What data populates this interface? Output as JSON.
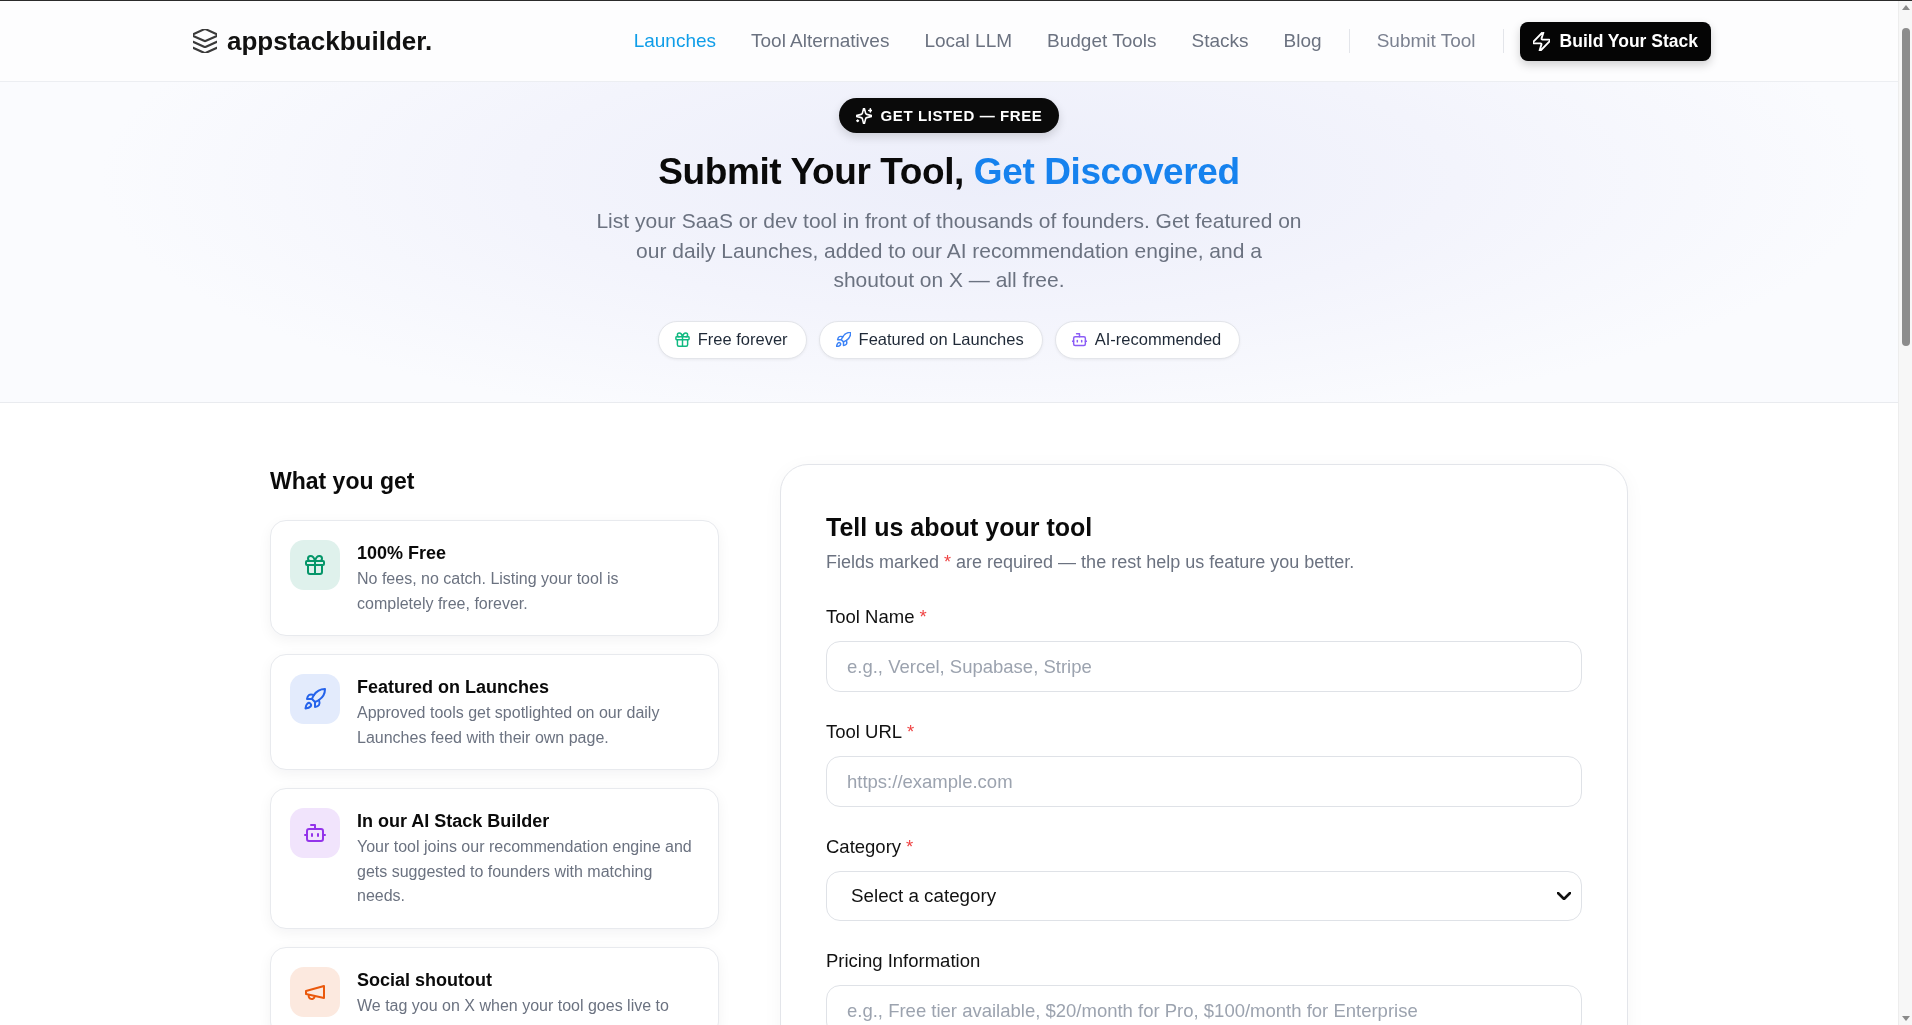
{
  "header": {
    "logo": "appstackbuilder.",
    "nav": [
      {
        "label": "Launches",
        "selected": true
      },
      {
        "label": "Tool Alternatives",
        "selected": false
      },
      {
        "label": "Local LLM",
        "selected": false
      },
      {
        "label": "Budget Tools",
        "selected": false
      },
      {
        "label": "Stacks",
        "selected": false
      },
      {
        "label": "Blog",
        "selected": false
      }
    ],
    "submit_link": "Submit Tool",
    "cta_button": "Build Your Stack"
  },
  "hero": {
    "badge": "GET LISTED — FREE",
    "title": "Submit Your Tool,",
    "title_highlight": "Get Discovered",
    "description": "List your SaaS or dev tool in front of thousands of founders. Get featured on our daily Launches, added to our AI recommendation engine, and a shoutout on X — all free.",
    "pills": [
      {
        "label": "Free forever",
        "kind": "gift",
        "color": "#10b981"
      },
      {
        "label": "Featured on Launches",
        "kind": "rocket",
        "color": "#3b82f6"
      },
      {
        "label": "AI-recommended",
        "kind": "robot",
        "color": "#8b5cf6"
      }
    ]
  },
  "benefits": {
    "title": "What you get",
    "items": [
      {
        "title": "100% Free",
        "description": "No fees, no catch. Listing your tool is completely free, forever.",
        "kind": "gift",
        "color": "#059669"
      },
      {
        "title": "Featured on Launches",
        "description": "Approved tools get spotlighted on our daily Launches feed with their own page.",
        "kind": "rocket",
        "color": "#2563eb"
      },
      {
        "title": "In our AI Stack Builder",
        "description": "Your tool joins our recommendation engine and gets suggested to founders with matching needs.",
        "kind": "robot",
        "color": "#9333ea"
      },
      {
        "title": "Social shoutout",
        "description": "We tag you on X when your tool goes live to",
        "kind": "megaphone",
        "color": "#ea580c"
      }
    ]
  },
  "form": {
    "title": "Tell us about your tool",
    "subtitle": {
      "before": "Fields marked",
      "mark": "*",
      "after": "are required — the rest help us feature you better."
    },
    "fields": [
      {
        "label": "Tool Name",
        "required_mark": "*",
        "kind": "text",
        "placeholder": "e.g., Vercel, Supabase, Stripe"
      },
      {
        "label": "Tool URL",
        "required_mark": "*",
        "kind": "text",
        "placeholder": "https://example.com"
      },
      {
        "label": "Category",
        "required_mark": "*",
        "kind": "select",
        "value": "Select a category"
      },
      {
        "label": "Pricing Information",
        "kind": "text",
        "placeholder": "e.g., Free tier available, $20/month for Pro, $100/month for Enterprise"
      }
    ]
  }
}
